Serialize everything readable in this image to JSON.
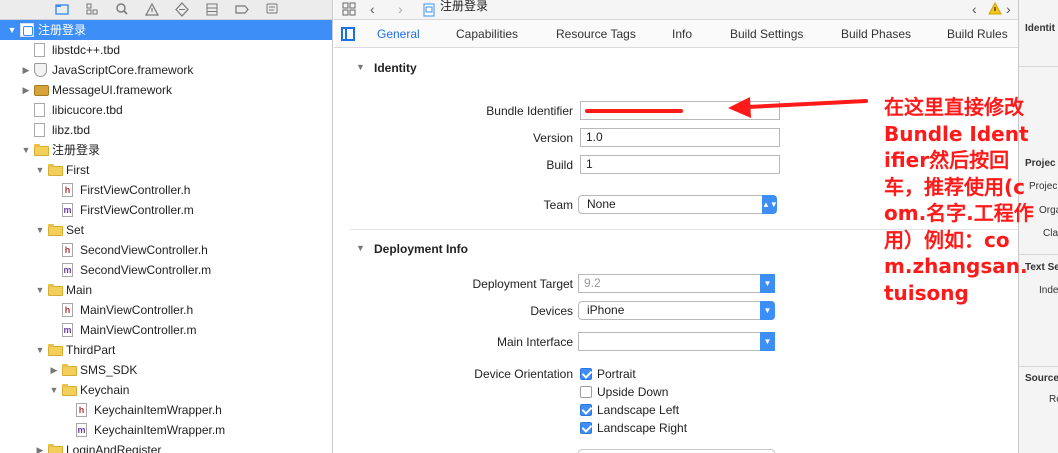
{
  "navigator": {
    "rows": [
      {
        "label": "注册登录",
        "kind": "project",
        "depth": 0,
        "disc": "down",
        "selected": true
      },
      {
        "label": "libstdc++.tbd",
        "kind": "doc",
        "depth": 1,
        "disc": ""
      },
      {
        "label": "JavaScriptCore.framework",
        "kind": "shield",
        "depth": 1,
        "disc": "right"
      },
      {
        "label": "MessageUI.framework",
        "kind": "toolbox",
        "depth": 1,
        "disc": "right"
      },
      {
        "label": "libicucore.tbd",
        "kind": "doc",
        "depth": 1,
        "disc": ""
      },
      {
        "label": "libz.tbd",
        "kind": "doc",
        "depth": 1,
        "disc": ""
      },
      {
        "label": "注册登录",
        "kind": "folder",
        "depth": 1,
        "disc": "down"
      },
      {
        "label": "First",
        "kind": "folder",
        "depth": 2,
        "disc": "down"
      },
      {
        "label": "FirstViewController.h",
        "kind": "h",
        "depth": 3,
        "disc": ""
      },
      {
        "label": "FirstViewController.m",
        "kind": "m",
        "depth": 3,
        "disc": ""
      },
      {
        "label": "Set",
        "kind": "folder",
        "depth": 2,
        "disc": "down"
      },
      {
        "label": "SecondViewController.h",
        "kind": "h",
        "depth": 3,
        "disc": ""
      },
      {
        "label": "SecondViewController.m",
        "kind": "m",
        "depth": 3,
        "disc": ""
      },
      {
        "label": "Main",
        "kind": "folder",
        "depth": 2,
        "disc": "down"
      },
      {
        "label": "MainViewController.h",
        "kind": "h",
        "depth": 3,
        "disc": ""
      },
      {
        "label": "MainViewController.m",
        "kind": "m",
        "depth": 3,
        "disc": ""
      },
      {
        "label": "ThirdPart",
        "kind": "folder",
        "depth": 2,
        "disc": "down"
      },
      {
        "label": "SMS_SDK",
        "kind": "folder",
        "depth": 3,
        "disc": "right"
      },
      {
        "label": "Keychain",
        "kind": "folder",
        "depth": 3,
        "disc": "down"
      },
      {
        "label": "KeychainItemWrapper.h",
        "kind": "h",
        "depth": 4,
        "disc": ""
      },
      {
        "label": "KeychainItemWrapper.m",
        "kind": "m",
        "depth": 4,
        "disc": ""
      },
      {
        "label": "LoginAndRegister",
        "kind": "folder",
        "depth": 2,
        "disc": "right"
      }
    ]
  },
  "jumpbar": {
    "title": "注册登录"
  },
  "tabs": [
    {
      "label": "General",
      "active": true
    },
    {
      "label": "Capabilities"
    },
    {
      "label": "Resource Tags"
    },
    {
      "label": "Info"
    },
    {
      "label": "Build Settings"
    },
    {
      "label": "Build Phases"
    },
    {
      "label": "Build Rules"
    }
  ],
  "identity": {
    "section_title": "Identity",
    "bundle_label": "Bundle Identifier",
    "bundle_value": "",
    "version_label": "Version",
    "version_value": "1.0",
    "build_label": "Build",
    "build_value": "1",
    "team_label": "Team",
    "team_value": "None"
  },
  "deployment": {
    "section_title": "Deployment Info",
    "target_label": "Deployment Target",
    "target_value": "9.2",
    "devices_label": "Devices",
    "devices_value": "iPhone",
    "interface_label": "Main Interface",
    "interface_value": "",
    "orientation_label": "Device Orientation",
    "orientations": [
      {
        "label": "Portrait",
        "checked": true
      },
      {
        "label": "Upside Down",
        "checked": false
      },
      {
        "label": "Landscape Left",
        "checked": true
      },
      {
        "label": "Landscape Right",
        "checked": true
      }
    ]
  },
  "inspector": {
    "identity_heading": "Identit",
    "project_heading": "Projec",
    "project_rows": [
      "Projec",
      "Orga",
      "Cla"
    ],
    "text_heading": "Text Se",
    "text_rows": [
      "Inde"
    ],
    "source_heading": "Source",
    "source_rows": [
      "Re"
    ]
  },
  "annotation": {
    "text": "在这里直接修改Bundle Identifier然后按回车，推荐使用(com.名字.工程作用）例如：com.zhangsan.tuisong"
  },
  "colors": {
    "accent": "#3d8ef7",
    "annotation": "#ff1a1a",
    "selection": "#3d8ef7"
  }
}
